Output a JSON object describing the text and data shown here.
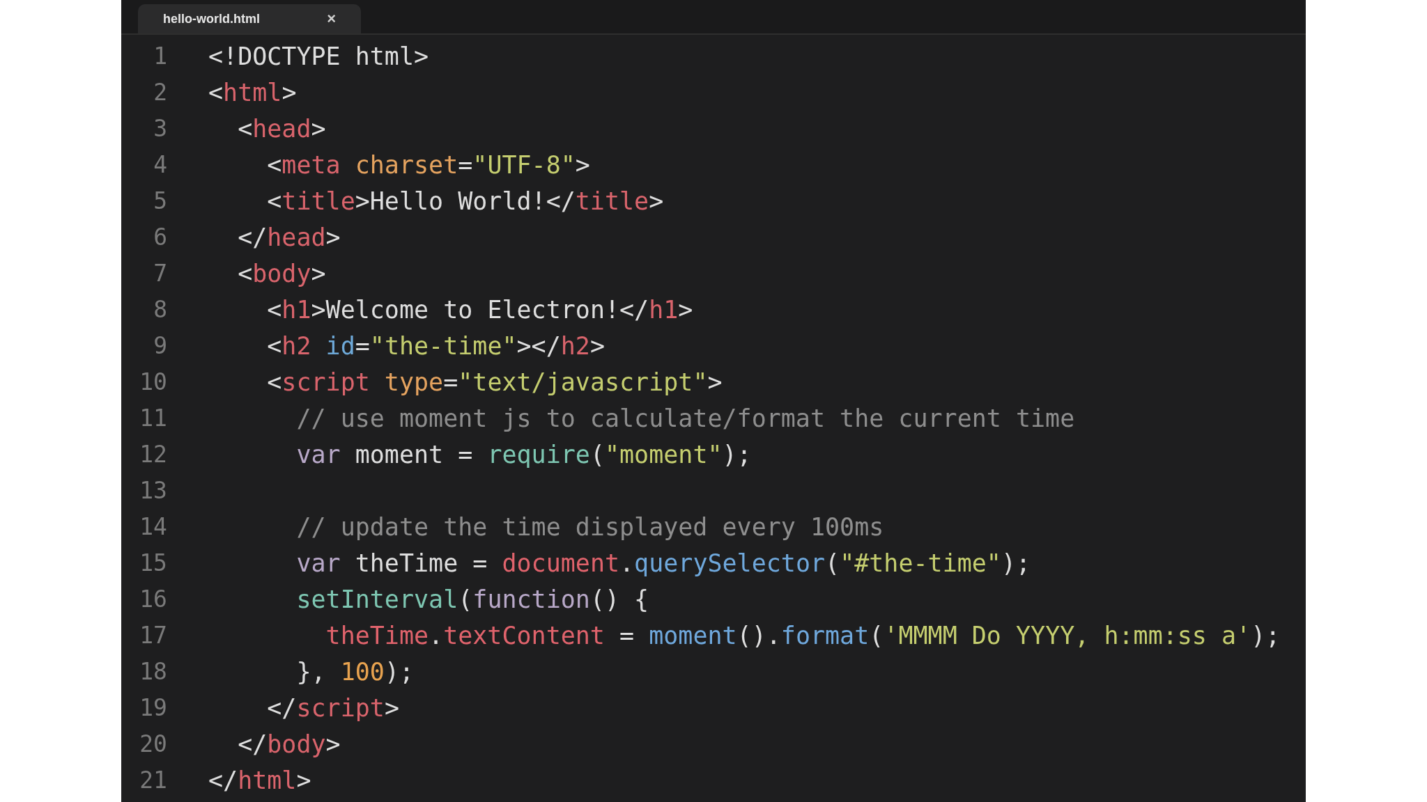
{
  "tab": {
    "title": "hello-world.html",
    "close": "×",
    "selected": true
  },
  "lines": [
    {
      "number": "1",
      "tokens": [
        {
          "t": "<!DOCTYPE html>",
          "kind": "plain"
        }
      ]
    },
    {
      "number": "2",
      "tokens": [
        {
          "t": "<",
          "kind": "plain"
        },
        {
          "t": "html",
          "kind": "tag"
        },
        {
          "t": ">",
          "kind": "plain"
        }
      ]
    },
    {
      "number": "3",
      "tokens": [
        {
          "t": "  <",
          "kind": "plain"
        },
        {
          "t": "head",
          "kind": "tag"
        },
        {
          "t": ">",
          "kind": "plain"
        }
      ]
    },
    {
      "number": "4",
      "tokens": [
        {
          "t": "    <",
          "kind": "plain"
        },
        {
          "t": "meta",
          "kind": "tag"
        },
        {
          "t": " charset",
          "kind": "attribute"
        },
        {
          "t": "=",
          "kind": "plain"
        },
        {
          "t": "\"UTF-8\"",
          "kind": "string"
        },
        {
          "t": ">",
          "kind": "plain"
        }
      ]
    },
    {
      "number": "5",
      "tokens": [
        {
          "t": "    <",
          "kind": "plain"
        },
        {
          "t": "title",
          "kind": "tag"
        },
        {
          "t": ">Hello World!</",
          "kind": "plain"
        },
        {
          "t": "title",
          "kind": "tag"
        },
        {
          "t": ">",
          "kind": "plain"
        }
      ]
    },
    {
      "number": "6",
      "tokens": [
        {
          "t": "  </",
          "kind": "plain"
        },
        {
          "t": "head",
          "kind": "tag"
        },
        {
          "t": ">",
          "kind": "plain"
        }
      ]
    },
    {
      "number": "7",
      "tokens": [
        {
          "t": "  <",
          "kind": "plain"
        },
        {
          "t": "body",
          "kind": "tag"
        },
        {
          "t": ">",
          "kind": "plain"
        }
      ]
    },
    {
      "number": "8",
      "tokens": [
        {
          "t": "    <",
          "kind": "plain"
        },
        {
          "t": "h1",
          "kind": "tag"
        },
        {
          "t": ">Welcome to Electron!</",
          "kind": "plain"
        },
        {
          "t": "h1",
          "kind": "tag"
        },
        {
          "t": ">",
          "kind": "plain"
        }
      ]
    },
    {
      "number": "9",
      "tokens": [
        {
          "t": "    <",
          "kind": "plain"
        },
        {
          "t": "h2",
          "kind": "tag"
        },
        {
          "t": " id",
          "kind": "id_attribute"
        },
        {
          "t": "=",
          "kind": "plain"
        },
        {
          "t": "\"the-time\"",
          "kind": "string"
        },
        {
          "t": "></",
          "kind": "plain"
        },
        {
          "t": "h2",
          "kind": "tag"
        },
        {
          "t": ">",
          "kind": "plain"
        }
      ]
    },
    {
      "number": "10",
      "tokens": [
        {
          "t": "    <",
          "kind": "plain"
        },
        {
          "t": "script",
          "kind": "tag"
        },
        {
          "t": " type",
          "kind": "attribute"
        },
        {
          "t": "=",
          "kind": "plain"
        },
        {
          "t": "\"text/javascript\"",
          "kind": "string"
        },
        {
          "t": ">",
          "kind": "plain"
        }
      ]
    },
    {
      "number": "11",
      "tokens": [
        {
          "t": "      // use moment js to calculate/format the current time",
          "kind": "comment"
        }
      ]
    },
    {
      "number": "12",
      "tokens": [
        {
          "t": "      var",
          "kind": "keyword"
        },
        {
          "t": " moment = ",
          "kind": "plain"
        },
        {
          "t": "require",
          "kind": "function"
        },
        {
          "t": "(",
          "kind": "plain"
        },
        {
          "t": "\"moment\"",
          "kind": "string"
        },
        {
          "t": ");",
          "kind": "plain"
        }
      ]
    },
    {
      "number": "13"
    },
    {
      "number": "14",
      "tokens": [
        {
          "t": "      // update the time displayed every 100ms",
          "kind": "comment"
        }
      ]
    },
    {
      "number": "15",
      "tokens": [
        {
          "t": "      var",
          "kind": "keyword"
        },
        {
          "t": " theTime = ",
          "kind": "plain"
        },
        {
          "t": "document",
          "kind": "variable"
        },
        {
          "t": ".",
          "kind": "plain"
        },
        {
          "t": "querySelector",
          "kind": "method"
        },
        {
          "t": "(",
          "kind": "plain"
        },
        {
          "t": "\"#the-time\"",
          "kind": "string"
        },
        {
          "t": ");",
          "kind": "plain"
        }
      ]
    },
    {
      "number": "16",
      "tokens": [
        {
          "t": "      setInterval",
          "kind": "function"
        },
        {
          "t": "(",
          "kind": "plain"
        },
        {
          "t": "function",
          "kind": "keyword"
        },
        {
          "t": "() {",
          "kind": "plain"
        }
      ]
    },
    {
      "number": "17",
      "tokens": [
        {
          "t": "        theTime",
          "kind": "variable"
        },
        {
          "t": ".",
          "kind": "plain"
        },
        {
          "t": "textContent",
          "kind": "variable"
        },
        {
          "t": " = ",
          "kind": "plain"
        },
        {
          "t": "moment",
          "kind": "method"
        },
        {
          "t": "().",
          "kind": "plain"
        },
        {
          "t": "format",
          "kind": "method"
        },
        {
          "t": "(",
          "kind": "plain"
        },
        {
          "t": "'MMMM Do YYYY, h:mm:ss a'",
          "kind": "string"
        },
        {
          "t": ");",
          "kind": "plain"
        }
      ]
    },
    {
      "number": "18",
      "tokens": [
        {
          "t": "      }, ",
          "kind": "plain"
        },
        {
          "t": "100",
          "kind": "number"
        },
        {
          "t": ");",
          "kind": "plain"
        }
      ]
    },
    {
      "number": "19",
      "tokens": [
        {
          "t": "    </",
          "kind": "plain"
        },
        {
          "t": "script",
          "kind": "tag"
        },
        {
          "t": ">",
          "kind": "plain"
        }
      ]
    },
    {
      "number": "20",
      "tokens": [
        {
          "t": "  </",
          "kind": "plain"
        },
        {
          "t": "body",
          "kind": "tag"
        },
        {
          "t": ">",
          "kind": "plain"
        }
      ]
    },
    {
      "number": "21",
      "tokens": [
        {
          "t": "</",
          "kind": "plain"
        },
        {
          "t": "html",
          "kind": "tag"
        },
        {
          "t": ">",
          "kind": "plain"
        }
      ]
    }
  ]
}
